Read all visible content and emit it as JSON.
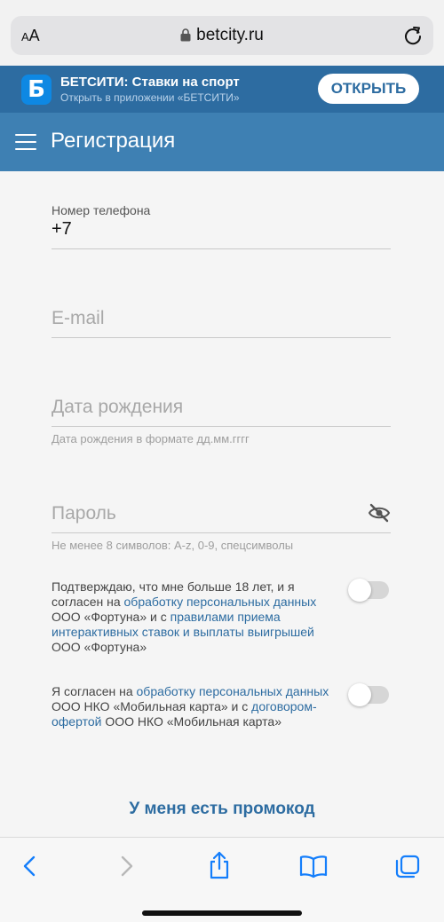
{
  "browser": {
    "aa_label_small": "A",
    "aa_label_large": "A",
    "url": "betcity.ru"
  },
  "banner": {
    "logo_letter": "Б",
    "title": "БЕТСИТИ: Ставки на спорт",
    "subtitle": "Открыть в приложении «БЕТСИТИ»",
    "open_label": "ОТКРЫТЬ"
  },
  "header": {
    "title": "Регистрация"
  },
  "form": {
    "phone": {
      "label": "Номер телефона",
      "value": "+7"
    },
    "email": {
      "placeholder": "E-mail"
    },
    "birthdate": {
      "placeholder": "Дата рождения",
      "hint": "Дата рождения в формате дд.мм.гггг"
    },
    "password": {
      "placeholder": "Пароль",
      "hint": "Не менее 8 символов: A-z, 0-9, спецсимволы"
    },
    "consent1": {
      "t1": "Подтверждаю, что мне больше 18 лет, и я согласен на ",
      "link1": "обработку персональных данных",
      "t2": " ООО «Фортуна» и с ",
      "link2": "правилами приема интерактивных ставок и выплаты выигрышей",
      "t3": " ООО «Фортуна»",
      "checked": false
    },
    "consent2": {
      "t1": "Я согласен на ",
      "link1": "обработку персональных данных",
      "t2": " ООО НКО «Мобильная карта» и с ",
      "link2": "договором-офертой",
      "t3": " ООО НКО «Мобильная карта»",
      "checked": false
    },
    "promo_label": "У меня есть промокод"
  },
  "colors": {
    "brand": "#2d6ca1",
    "header": "#3e80b3",
    "link": "#2d6ca1",
    "safari_blue": "#147efb"
  },
  "toolbar": {
    "icons": [
      "back-icon",
      "forward-icon",
      "share-icon",
      "bookmarks-icon",
      "tabs-icon"
    ]
  }
}
